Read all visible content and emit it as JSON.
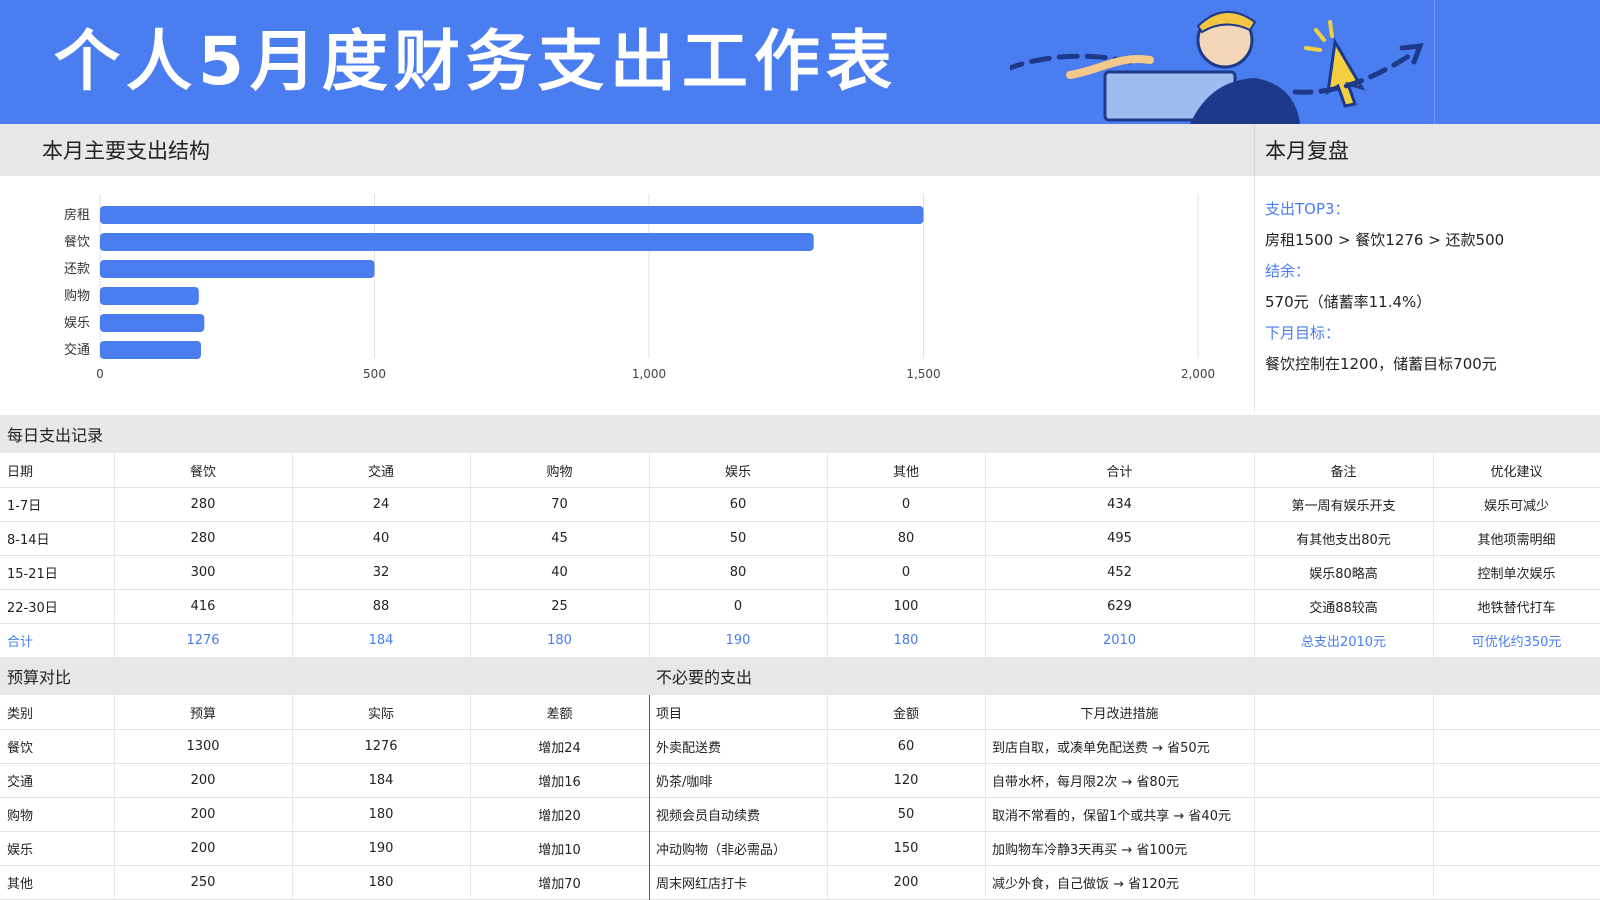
{
  "title": "个人5月度财务支出工作表",
  "colors": {
    "accent": "#4a7df0",
    "header_bg": "#e8e8e8"
  },
  "chart_section": {
    "title": "本月主要支出结构"
  },
  "review": {
    "title": "本月复盘",
    "top3_label": "支出TOP3：",
    "top3_text": "房租1500 > 餐饮1276 > 还款500",
    "balance_label": "结余：",
    "balance_text": "570元（储蓄率11.4%）",
    "goal_label": "下月目标：",
    "goal_text": "餐饮控制在1200，储蓄目标700元"
  },
  "chart_data": {
    "type": "bar",
    "orientation": "horizontal",
    "categories": [
      "房租",
      "餐饮",
      "还款",
      "购物",
      "娱乐",
      "交通"
    ],
    "values": [
      1500,
      1300,
      500,
      180,
      190,
      184
    ],
    "xlim": [
      0,
      2000
    ],
    "xticks": [
      0,
      500,
      1000,
      1500,
      2000
    ],
    "xtick_labels": [
      "0",
      "500",
      "1,000",
      "1,500",
      "2,000"
    ],
    "grid": true,
    "bar_color": "#4a7df0"
  },
  "daily": {
    "title": "每日支出记录",
    "headers": [
      "日期",
      "餐饮",
      "交通",
      "购物",
      "娱乐",
      "其他",
      "合计",
      "备注",
      "优化建议"
    ],
    "rows": [
      [
        "1-7日",
        "280",
        "24",
        "70",
        "60",
        "0",
        "434",
        "第一周有娱乐开支",
        "娱乐可减少"
      ],
      [
        "8-14日",
        "280",
        "40",
        "45",
        "50",
        "80",
        "495",
        "有其他支出80元",
        "其他项需明细"
      ],
      [
        "15-21日",
        "300",
        "32",
        "40",
        "80",
        "0",
        "452",
        "娱乐80略高",
        "控制单次娱乐"
      ],
      [
        "22-30日",
        "416",
        "88",
        "25",
        "0",
        "100",
        "629",
        "交通88较高",
        "地铁替代打车"
      ]
    ],
    "total": [
      "合计",
      "1276",
      "184",
      "180",
      "190",
      "180",
      "2010",
      "总支出2010元",
      "可优化约350元"
    ]
  },
  "budget": {
    "title": "预算对比",
    "headers": [
      "类别",
      "预算",
      "实际",
      "差额"
    ],
    "rows": [
      [
        "餐饮",
        "1300",
        "1276",
        "增加24"
      ],
      [
        "交通",
        "200",
        "184",
        "增加16"
      ],
      [
        "购物",
        "200",
        "180",
        "增加20"
      ],
      [
        "娱乐",
        "200",
        "190",
        "增加10"
      ],
      [
        "其他",
        "250",
        "180",
        "增加70"
      ]
    ]
  },
  "unnecessary": {
    "title": "不必要的支出",
    "headers": [
      "项目",
      "金额",
      "下月改进措施"
    ],
    "rows": [
      [
        "外卖配送费",
        "60",
        "到店自取，或凑单免配送费 → 省50元"
      ],
      [
        "奶茶/咖啡",
        "120",
        "自带水杯，每月限2次 → 省80元"
      ],
      [
        "视频会员自动续费",
        "50",
        "取消不常看的，保留1个或共享 → 省40元"
      ],
      [
        "冲动购物（非必需品）",
        "150",
        "加购物车冷静3天再买 → 省100元"
      ],
      [
        "周末网红店打卡",
        "200",
        "减少外食，自己做饭 → 省120元"
      ]
    ]
  }
}
